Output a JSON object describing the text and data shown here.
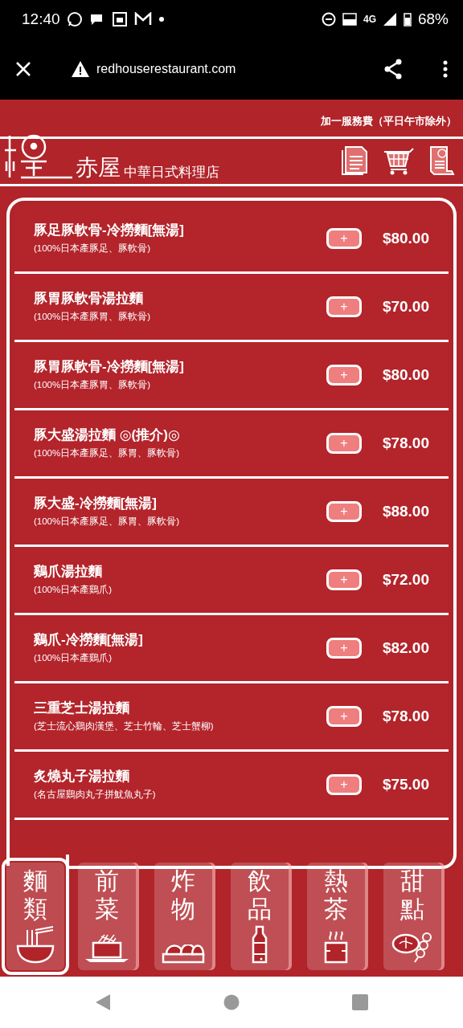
{
  "status_bar": {
    "time": "12:40",
    "network": "4G",
    "battery": "68%"
  },
  "browser": {
    "url": "redhouserestaurant.com"
  },
  "header": {
    "notice": "加一服務費（平日午市除外）",
    "brand": "赤屋",
    "subtitle": "中華日式料理店"
  },
  "menu_items": [
    {
      "name": "豚足豚軟骨-冷撈麵[無湯]",
      "description": "(100%日本產豚足、豚軟骨)",
      "button": "+",
      "price": "$80.00"
    },
    {
      "name": "豚胃豚軟骨湯拉麵",
      "description": "(100%日本產豚胃、豚軟骨)",
      "button": "+",
      "price": "$70.00"
    },
    {
      "name": "豚胃豚軟骨-冷撈麵[無湯]",
      "description": "(100%日本產豚胃、豚軟骨)",
      "button": "+",
      "price": "$80.00"
    },
    {
      "name": "豚大盛湯拉麵 ◎(推介)◎",
      "description": "(100%日本產豚足、豚胃、豚軟骨)",
      "button": "+",
      "price": "$78.00"
    },
    {
      "name": "豚大盛-冷撈麵[無湯]",
      "description": "(100%日本產豚足、豚胃、豚軟骨)",
      "button": "+",
      "price": "$88.00"
    },
    {
      "name": "鷄爪湯拉麵",
      "description": "(100%日本產鷄爪)",
      "button": "+",
      "price": "$72.00"
    },
    {
      "name": "鷄爪-冷撈麵[無湯]",
      "description": "(100%日本產鷄爪)",
      "button": "+",
      "price": "$82.00"
    },
    {
      "name": "三重芝士湯拉麵",
      "description": "(芝士流心鷄肉漢堡、芝士竹輪、芝士蟹柳)",
      "button": "+",
      "price": "$78.00"
    },
    {
      "name": "炙燒丸子湯拉麵",
      "description": "(名古屋鷄肉丸子拼魷魚丸子)",
      "button": "+",
      "price": "$75.00"
    }
  ],
  "categories": [
    {
      "label": "麵類",
      "selected": true
    },
    {
      "label": "前菜",
      "selected": false
    },
    {
      "label": "炸物",
      "selected": false
    },
    {
      "label": "飲品",
      "selected": false
    },
    {
      "label": "熱茶",
      "selected": false
    },
    {
      "label": "甜點",
      "selected": false
    }
  ]
}
